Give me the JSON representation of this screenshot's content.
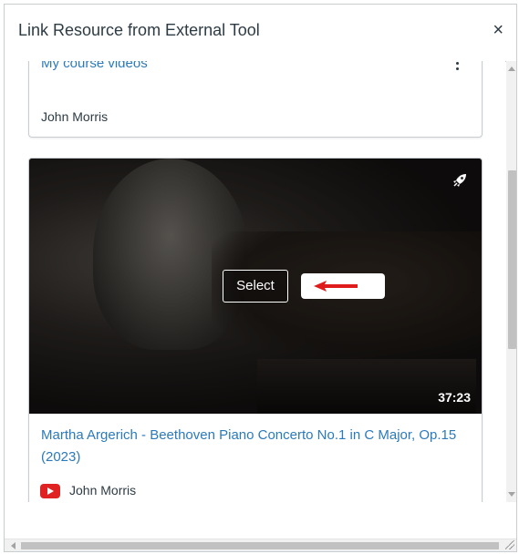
{
  "dialog": {
    "title": "Link Resource from External Tool",
    "close_label": "×"
  },
  "items": [
    {
      "title": "My course videos",
      "author": "John Morris"
    },
    {
      "title": "Martha Argerich - Beethoven Piano Concerto No.1 in C Major, Op.15 (2023)",
      "author": "John Morris",
      "duration": "37:23",
      "select_label": "Select",
      "source_icon": "youtube-icon",
      "badge_icon": "rocket-icon"
    }
  ],
  "colors": {
    "link": "#2b7abc",
    "text": "#2d3b45",
    "youtube": "#e02222",
    "arrow": "#e01b1b"
  }
}
